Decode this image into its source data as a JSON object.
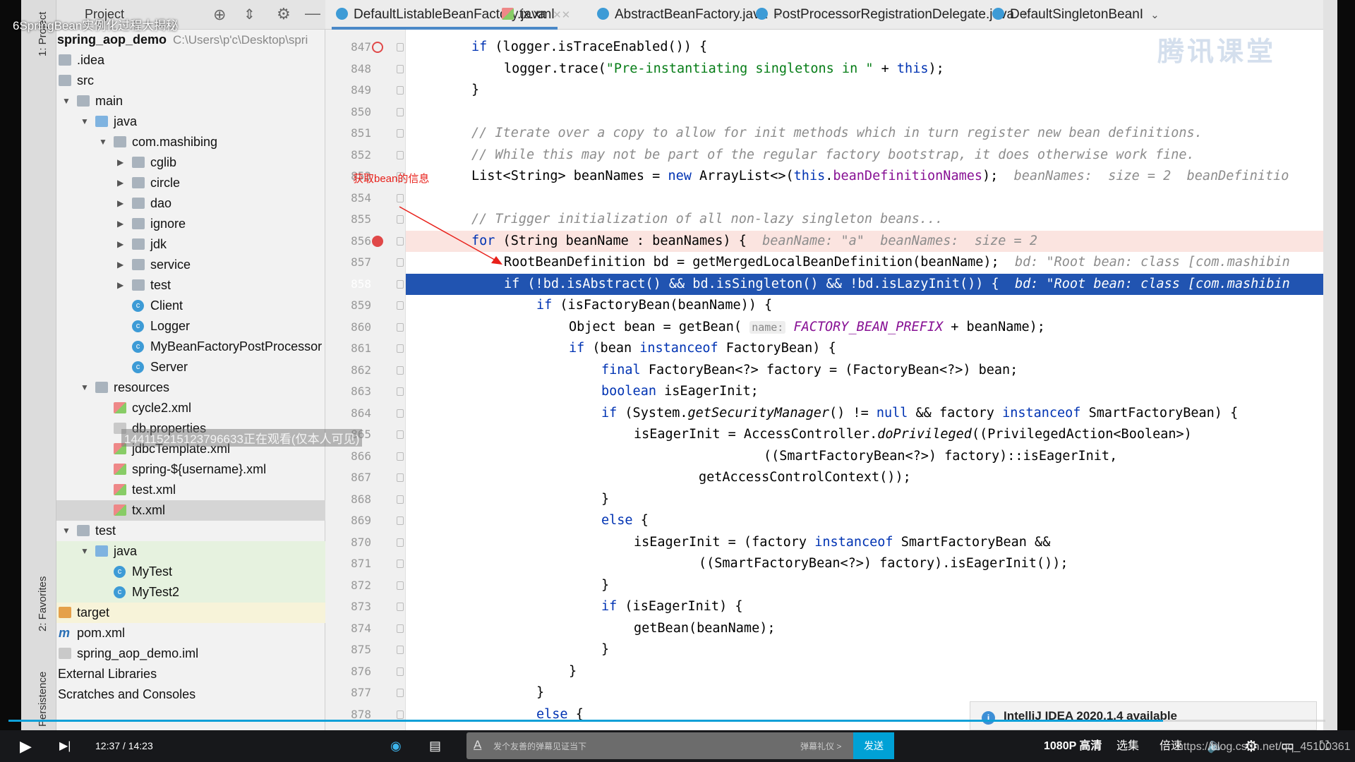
{
  "video_title": "6SpringBean实例化过程大揭秘",
  "logo_text": "腾讯课堂",
  "tool_strip": {
    "project": "1: Project",
    "favorites": "2: Favorites",
    "persistence": "Persistence"
  },
  "project_panel": {
    "header": "Project",
    "root": "spring_aop_demo",
    "root_path": "C:\\Users\\p'c\\Desktop\\spri",
    "items": [
      {
        "label": ".idea",
        "depth": 0,
        "icon": "folder",
        "arrow": ""
      },
      {
        "label": "src",
        "depth": 0,
        "icon": "folder",
        "arrow": ""
      },
      {
        "label": "main",
        "depth": 1,
        "icon": "folder",
        "arrow": "down"
      },
      {
        "label": "java",
        "depth": 2,
        "icon": "folder-blue",
        "arrow": "down"
      },
      {
        "label": "com.mashibing",
        "depth": 3,
        "icon": "folder",
        "arrow": "down"
      },
      {
        "label": "cglib",
        "depth": 4,
        "icon": "folder",
        "arrow": "right"
      },
      {
        "label": "circle",
        "depth": 4,
        "icon": "folder",
        "arrow": "right"
      },
      {
        "label": "dao",
        "depth": 4,
        "icon": "folder",
        "arrow": "right"
      },
      {
        "label": "ignore",
        "depth": 4,
        "icon": "folder",
        "arrow": "right"
      },
      {
        "label": "jdk",
        "depth": 4,
        "icon": "folder",
        "arrow": "right"
      },
      {
        "label": "service",
        "depth": 4,
        "icon": "folder",
        "arrow": "right"
      },
      {
        "label": "test",
        "depth": 4,
        "icon": "folder",
        "arrow": "right"
      },
      {
        "label": "Client",
        "depth": 4,
        "icon": "class",
        "arrow": ""
      },
      {
        "label": "Logger",
        "depth": 4,
        "icon": "class",
        "arrow": ""
      },
      {
        "label": "MyBeanFactoryPostProcessor",
        "depth": 4,
        "icon": "class",
        "arrow": ""
      },
      {
        "label": "Server",
        "depth": 4,
        "icon": "class",
        "arrow": ""
      },
      {
        "label": "resources",
        "depth": 2,
        "icon": "folder",
        "arrow": "down"
      },
      {
        "label": "cycle2.xml",
        "depth": 3,
        "icon": "xml",
        "arrow": ""
      },
      {
        "label": "db.properties",
        "depth": 3,
        "icon": "file",
        "arrow": ""
      },
      {
        "label": "jdbcTemplate.xml",
        "depth": 3,
        "icon": "xml",
        "arrow": ""
      },
      {
        "label": "spring-${username}.xml",
        "depth": 3,
        "icon": "xml",
        "arrow": ""
      },
      {
        "label": "test.xml",
        "depth": 3,
        "icon": "xml",
        "arrow": ""
      },
      {
        "label": "tx.xml",
        "depth": 3,
        "icon": "xml",
        "arrow": "",
        "selected": true
      },
      {
        "label": "test",
        "depth": 1,
        "icon": "folder",
        "arrow": "down"
      },
      {
        "label": "java",
        "depth": 2,
        "icon": "folder-blue",
        "arrow": "down",
        "bg": "#e6f2df"
      },
      {
        "label": "MyTest",
        "depth": 3,
        "icon": "class",
        "arrow": "",
        "bg": "#e6f2df"
      },
      {
        "label": "MyTest2",
        "depth": 3,
        "icon": "class",
        "arrow": "",
        "bg": "#e6f2df"
      },
      {
        "label": "target",
        "depth": 0,
        "icon": "folder-orange",
        "arrow": "",
        "bg": "#f7f3d9"
      },
      {
        "label": "pom.xml",
        "depth": 0,
        "icon": "pom",
        "arrow": ""
      },
      {
        "label": "spring_aop_demo.iml",
        "depth": 0,
        "icon": "file",
        "arrow": ""
      },
      {
        "label": "External Libraries",
        "depth": -1,
        "icon": "",
        "arrow": ""
      },
      {
        "label": "Scratches and Consoles",
        "depth": -1,
        "icon": "",
        "arrow": ""
      }
    ]
  },
  "tabs": [
    {
      "label": "DefaultListableBeanFactory.java",
      "active": true
    },
    {
      "label": "tx.xml"
    },
    {
      "label": "AbstractBeanFactory.java"
    },
    {
      "label": "PostProcessorRegistrationDelegate.java"
    },
    {
      "label": "DefaultSingletonBeanI"
    }
  ],
  "editor": {
    "lines": [
      {
        "n": "847",
        "indent": 0,
        "bp": "ring",
        "t": [
          [
            "if",
            "kw"
          ],
          [
            " (logger.isTraceEnabled()) {",
            ""
          ]
        ]
      },
      {
        "n": "848",
        "indent": 1,
        "t": [
          [
            "logger.trace(",
            ""
          ],
          [
            "\"Pre-instantiating singletons in \"",
            "st"
          ],
          [
            " + ",
            ""
          ],
          [
            "this",
            "kw"
          ],
          [
            ");",
            ""
          ]
        ]
      },
      {
        "n": "849",
        "indent": 0,
        "t": [
          [
            "}",
            ""
          ]
        ]
      },
      {
        "n": "850",
        "indent": 0,
        "t": []
      },
      {
        "n": "851",
        "indent": 0,
        "t": [
          [
            "// Iterate over a copy to allow for init methods which in turn register new bean definitions.",
            "cm"
          ]
        ]
      },
      {
        "n": "852",
        "indent": 0,
        "t": [
          [
            "// While this may not be part of the regular factory bootstrap, it does otherwise work fine.",
            "cm"
          ]
        ]
      },
      {
        "n": "853",
        "indent": 0,
        "t": [
          [
            "List<String> beanNames = ",
            ""
          ],
          [
            "new",
            "kw"
          ],
          [
            " ArrayList<>(",
            ""
          ],
          [
            "this",
            "kw"
          ],
          [
            ".",
            ""
          ],
          [
            "beanDefinitionNames",
            "fd"
          ],
          [
            ");  ",
            ""
          ],
          [
            "beanNames:  size = 2  beanDefinitio",
            "hint"
          ]
        ]
      },
      {
        "n": "854",
        "indent": 0,
        "t": []
      },
      {
        "n": "855",
        "indent": 0,
        "t": [
          [
            "// Trigger initialization of all non-lazy singleton beans...",
            "cm"
          ]
        ]
      },
      {
        "n": "856",
        "indent": 0,
        "bp": "hit",
        "style": "pink",
        "t": [
          [
            "for",
            "kw"
          ],
          [
            " (String beanName : beanNames) {  ",
            ""
          ],
          [
            "beanName: \"a\"  beanNames:  size = 2",
            "hint"
          ]
        ]
      },
      {
        "n": "857",
        "indent": 1,
        "t": [
          [
            "RootBeanDefinition bd = getMergedLocalBeanDefinition(beanName);  ",
            ""
          ],
          [
            "bd: \"Root bean: class [com.mashibin",
            "hint"
          ]
        ]
      },
      {
        "n": "858",
        "indent": 1,
        "style": "sel",
        "t": [
          [
            "if (!bd.isAbstract() && bd.isSingleton() && !bd.isLazyInit()) {  ",
            ""
          ],
          [
            "bd: \"Root bean: class [com.mashibin",
            "hint"
          ]
        ]
      },
      {
        "n": "859",
        "indent": 2,
        "t": [
          [
            "if",
            "kw"
          ],
          [
            " (isFactoryBean(beanName)) {",
            ""
          ]
        ]
      },
      {
        "n": "860",
        "indent": 3,
        "t": [
          [
            "Object bean = getBean( ",
            ""
          ],
          [
            "name:",
            "pname"
          ],
          [
            " ",
            ""
          ],
          [
            "FACTORY_BEAN_PREFIX",
            "cn"
          ],
          [
            " + beanName);",
            ""
          ]
        ]
      },
      {
        "n": "861",
        "indent": 3,
        "t": [
          [
            "if",
            "kw"
          ],
          [
            " (bean ",
            ""
          ],
          [
            "instanceof",
            "kw"
          ],
          [
            " FactoryBean) {",
            ""
          ]
        ]
      },
      {
        "n": "862",
        "indent": 4,
        "t": [
          [
            "final",
            "kw"
          ],
          [
            " FactoryBean<?> factory = (FactoryBean<?>) bean;",
            ""
          ]
        ]
      },
      {
        "n": "863",
        "indent": 4,
        "t": [
          [
            "boolean",
            "kw"
          ],
          [
            " isEagerInit;",
            ""
          ]
        ]
      },
      {
        "n": "864",
        "indent": 4,
        "t": [
          [
            "if",
            "kw"
          ],
          [
            " (System.",
            ""
          ],
          [
            "getSecurityManager",
            "it"
          ],
          [
            "() != ",
            ""
          ],
          [
            "null",
            "kw"
          ],
          [
            " && factory ",
            ""
          ],
          [
            "instanceof",
            "kw"
          ],
          [
            " SmartFactoryBean) {",
            ""
          ]
        ]
      },
      {
        "n": "865",
        "indent": 5,
        "t": [
          [
            "isEagerInit = AccessController.",
            ""
          ],
          [
            "doPrivileged",
            "it"
          ],
          [
            "((PrivilegedAction<Boolean>)",
            ""
          ]
        ]
      },
      {
        "n": "866",
        "indent": 9,
        "t": [
          [
            "((SmartFactoryBean<?>) factory)::isEagerInit,",
            ""
          ]
        ]
      },
      {
        "n": "867",
        "indent": 7,
        "t": [
          [
            "getAccessControlContext());",
            ""
          ]
        ]
      },
      {
        "n": "868",
        "indent": 4,
        "t": [
          [
            "}",
            ""
          ]
        ]
      },
      {
        "n": "869",
        "indent": 4,
        "t": [
          [
            "else",
            "kw"
          ],
          [
            " {",
            ""
          ]
        ]
      },
      {
        "n": "870",
        "indent": 5,
        "t": [
          [
            "isEagerInit = (factory ",
            ""
          ],
          [
            "instanceof",
            "kw"
          ],
          [
            " SmartFactoryBean &&",
            ""
          ]
        ]
      },
      {
        "n": "871",
        "indent": 7,
        "t": [
          [
            "((SmartFactoryBean<?>) factory).isEagerInit());",
            ""
          ]
        ]
      },
      {
        "n": "872",
        "indent": 4,
        "t": [
          [
            "}",
            ""
          ]
        ]
      },
      {
        "n": "873",
        "indent": 4,
        "t": [
          [
            "if",
            "kw"
          ],
          [
            " (isEagerInit) {",
            ""
          ]
        ]
      },
      {
        "n": "874",
        "indent": 5,
        "t": [
          [
            "getBean(beanName);",
            ""
          ]
        ]
      },
      {
        "n": "875",
        "indent": 4,
        "t": [
          [
            "}",
            ""
          ]
        ]
      },
      {
        "n": "876",
        "indent": 3,
        "t": [
          [
            "}",
            ""
          ]
        ]
      },
      {
        "n": "877",
        "indent": 2,
        "t": [
          [
            "}",
            ""
          ]
        ]
      },
      {
        "n": "878",
        "indent": 2,
        "t": [
          [
            "else",
            "kw"
          ],
          [
            " {",
            ""
          ]
        ]
      }
    ]
  },
  "annotation": "获取bean的信息",
  "viewer_watermark": "144115215123796633正在观看(仅本人可见)",
  "notification": "IntelliJ IDEA 2020.1.4 available",
  "player": {
    "time": "12:37 / 14:23",
    "progress": 0.877,
    "danmaku_placeholder": "发个友善的弹幕见证当下",
    "danmaku_etiquette": "弹幕礼仪 >",
    "send": "发送",
    "quality": "1080P 高清",
    "episodes": "选集",
    "speed": "倍速"
  },
  "url_watermark": "https://blog.csdn.net/qq_45100361",
  "colors": {
    "selection": "#2154b1",
    "accent": "#00a1d6",
    "breakpoint": "#e04848"
  }
}
